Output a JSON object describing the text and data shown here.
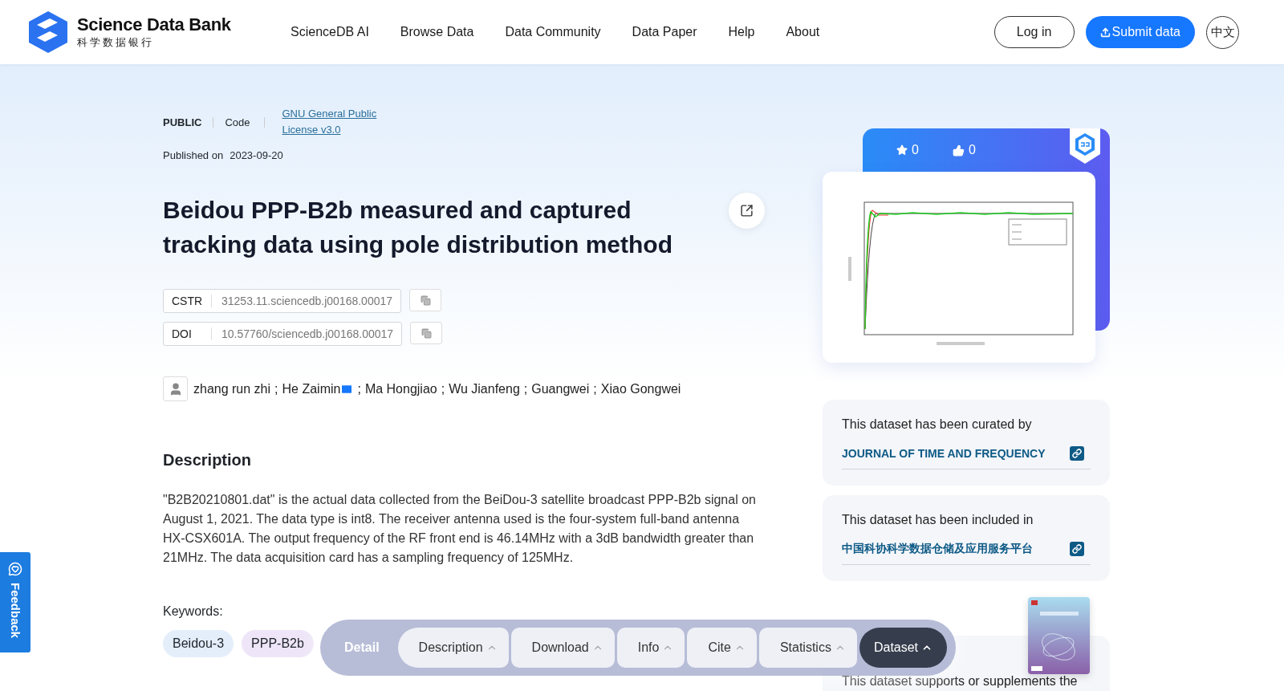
{
  "header": {
    "logo_title": "Science Data Bank",
    "logo_subtitle": "科学数据银行",
    "nav": [
      {
        "label": "ScienceDB AI"
      },
      {
        "label": "Browse Data"
      },
      {
        "label": "Data Community"
      },
      {
        "label": "Data Paper"
      },
      {
        "label": "Help"
      },
      {
        "label": "About"
      }
    ],
    "login": "Log in",
    "submit": "Submit data",
    "language": "中文"
  },
  "meta": {
    "access": "PUBLIC",
    "type": "Code",
    "license": "GNU General Public License v3.0",
    "published_label": "Published on",
    "published_date": "2023-09-20"
  },
  "title": "Beidou PPP-B2b measured and captured tracking data using pole distribution method",
  "identifiers": [
    {
      "label": "CSTR",
      "value": "31253.11.sciencedb.j00168.00017"
    },
    {
      "label": "DOI",
      "value": "10.57760/sciencedb.j00168.00017"
    }
  ],
  "authors": [
    {
      "name": "zhang run zhi",
      "email": false
    },
    {
      "name": "He Zaimin",
      "email": true
    },
    {
      "name": "Ma Hongjiao",
      "email": false
    },
    {
      "name": "Wu Jianfeng",
      "email": false
    },
    {
      "name": "Guangwei",
      "email": false
    },
    {
      "name": "Xiao Gongwei",
      "email": false
    }
  ],
  "author_separator": ";",
  "description": {
    "heading": "Description",
    "text": "\"B2B20210801.dat\" is the actual data collected from the BeiDou-3 satellite broadcast PPP-B2b signal on August 1, 2021. The data type is int8. The receiver antenna used is the four-system full-band antenna HX-CSX601A. The output frequency of the RF front end is 46.14MHz with a 3dB bandwidth greater than 21MHz. The data acquisition card has a sampling frequency of 125MHz."
  },
  "keywords": {
    "label": "Keywords:",
    "items": [
      {
        "label": "Beidou-3",
        "color": "#e4eefb"
      },
      {
        "label": "PPP-B2b",
        "color": "#eee6f8"
      }
    ]
  },
  "stats": {
    "stars": "0",
    "likes": "0"
  },
  "curated": {
    "text": "This dataset has been curated by",
    "link": "JOURNAL OF TIME AND FREQUENCY"
  },
  "included": {
    "text": "This dataset has been included in",
    "link": "中国科协科学数据仓储及应用服务平台"
  },
  "supports": {
    "text": "This dataset supports or supplements the"
  },
  "section_nav": {
    "label": "Detail",
    "items": [
      {
        "label": "Description",
        "selected": false
      },
      {
        "label": "Download",
        "selected": false
      },
      {
        "label": "Info",
        "selected": false
      },
      {
        "label": "Cite",
        "selected": false
      },
      {
        "label": "Statistics",
        "selected": false
      },
      {
        "label": "Dataset",
        "selected": true
      }
    ]
  },
  "feedback": "Feedback"
}
